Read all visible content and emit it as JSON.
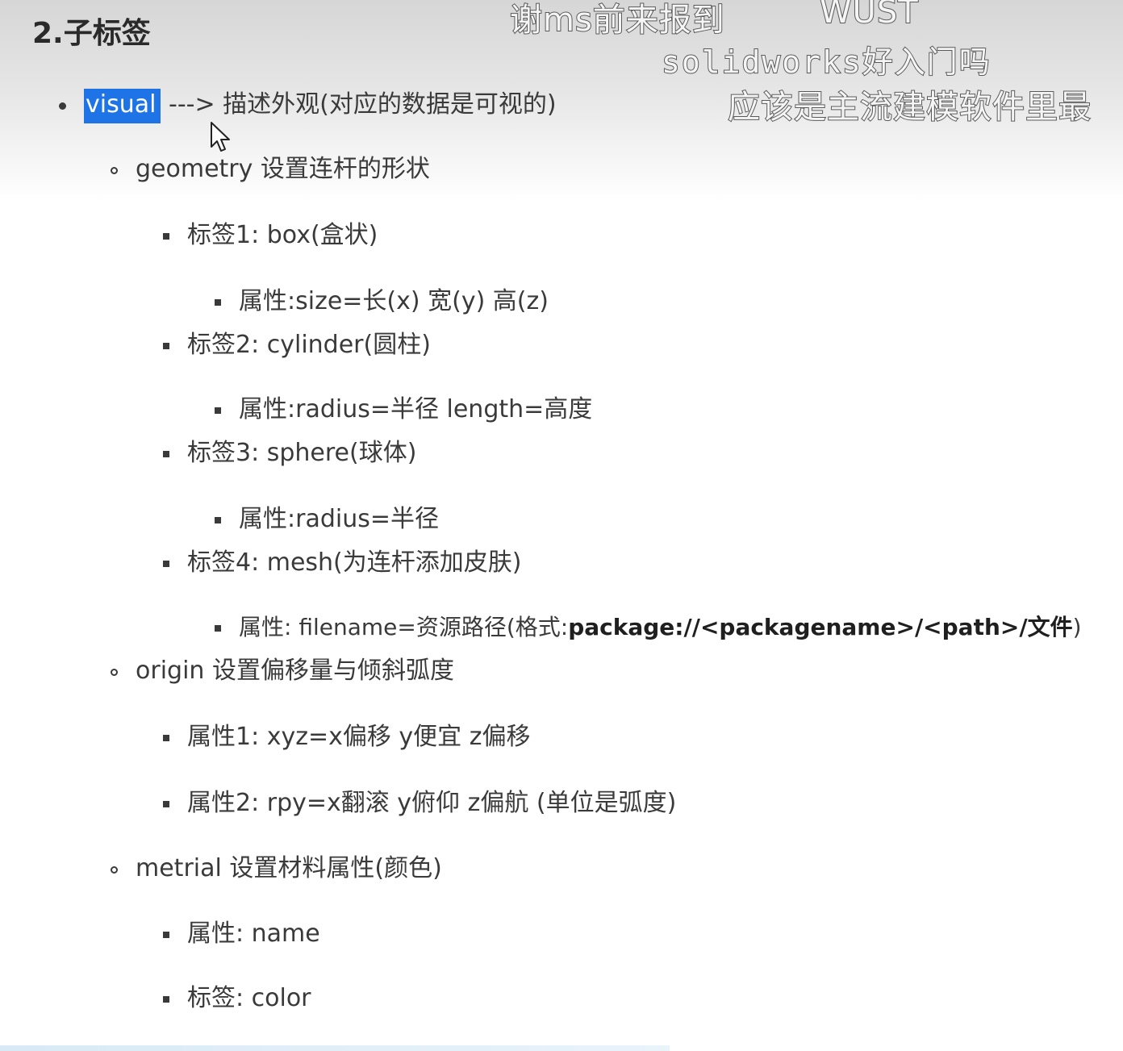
{
  "heading": "2.子标签",
  "overlays": {
    "line1a": "谢ms前来报到",
    "line1b": "WUST",
    "line2": "solidworks好入门吗",
    "line3": "应该是主流建模软件里最"
  },
  "visual": {
    "keyword": "visual",
    "desc": "---> 描述外观(对应的数据是可视的)"
  },
  "geometry": {
    "label": "geometry 设置连杆的形状",
    "tags": [
      {
        "label": "标签1: box(盒状)",
        "attr": "属性:size=长(x) 宽(y) 高(z)"
      },
      {
        "label": "标签2: cylinder(圆柱)",
        "attr": "属性:radius=半径 length=高度"
      },
      {
        "label": "标签3: sphere(球体)",
        "attr": "属性:radius=半径"
      },
      {
        "label": "标签4: mesh(为连杆添加皮肤)",
        "attr_prefix": "属性: filename=资源路径(格式:",
        "attr_bold": "package://<packagename>/<path>/文件",
        "attr_suffix": ")"
      }
    ]
  },
  "origin": {
    "label": "origin 设置偏移量与倾斜弧度",
    "attrs": [
      "属性1: xyz=x偏移 y便宜 z偏移",
      "属性2: rpy=x翻滚 y俯仰 z偏航 (单位是弧度)"
    ]
  },
  "metrial": {
    "label": "metrial 设置材料属性(颜色)",
    "items": [
      "属性: name",
      "标签: color"
    ]
  }
}
